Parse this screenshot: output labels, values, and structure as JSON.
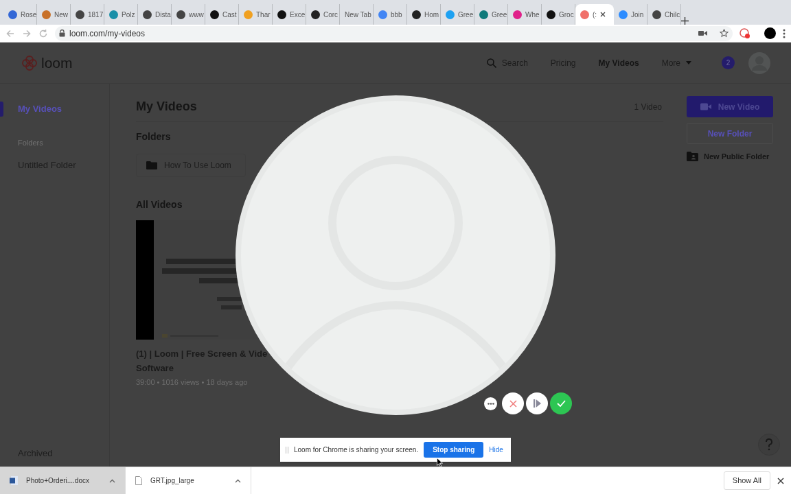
{
  "browser": {
    "tabs": [
      {
        "label": "Rose",
        "color": "#3367d6",
        "selected": false
      },
      {
        "label": "New",
        "color": "#c8712a",
        "selected": false
      },
      {
        "label": "1817",
        "color": "#444444",
        "selected": false
      },
      {
        "label": "Polz",
        "color": "#1a8fa8",
        "selected": false
      },
      {
        "label": "Dista",
        "color": "#444444",
        "selected": false
      },
      {
        "label": "www",
        "color": "#444444",
        "selected": false
      },
      {
        "label": "Cast",
        "color": "#111111",
        "selected": false
      },
      {
        "label": "Thar",
        "color": "#f0a020",
        "selected": false
      },
      {
        "label": "Exce",
        "color": "#111111",
        "selected": false
      },
      {
        "label": "Corc",
        "color": "#222222",
        "selected": false
      },
      {
        "label": "New Tab",
        "selected": false
      },
      {
        "label": "bbb",
        "color": "#4285f4",
        "selected": false
      },
      {
        "label": "Hom",
        "color": "#222222",
        "selected": false
      },
      {
        "label": "Gree",
        "color": "#1da1f2",
        "selected": false
      },
      {
        "label": "Gree",
        "color": "#0f7a7a",
        "selected": false
      },
      {
        "label": "Whe",
        "color": "#e0218a",
        "selected": false
      },
      {
        "label": "Groc",
        "color": "#111111",
        "selected": false
      },
      {
        "label": "(:",
        "color": "#f0706a",
        "selected": true
      },
      {
        "label": "Join",
        "color": "#2d8cff",
        "selected": false
      },
      {
        "label": "Chilc",
        "color": "#444444",
        "selected": false
      }
    ],
    "url": "loom.com/my-videos"
  },
  "header": {
    "logo": "loom",
    "nav": [
      {
        "label": "Search",
        "kind": "search",
        "selected": false
      },
      {
        "label": "Pricing",
        "kind": "link",
        "selected": false
      },
      {
        "label": "My Videos",
        "kind": "link",
        "selected": true
      },
      {
        "label": "More",
        "kind": "menu",
        "selected": false
      }
    ],
    "badge": "2"
  },
  "sidebar": {
    "items": [
      {
        "label": "My Videos",
        "selected": true
      }
    ],
    "folders_label": "Folders",
    "folders": [
      "Untitled Folder"
    ],
    "archived": "Archived"
  },
  "main": {
    "title": "My Videos",
    "video_count": "1 Video",
    "folders_heading": "Folders",
    "folders": [
      "How To Use Loom"
    ],
    "all_videos_heading": "All Videos",
    "videos": [
      {
        "title_lines": [
          "(1) | Loom | Free Screen & Vide",
          "Software"
        ],
        "meta": "39:00 • 1016 views • 18 days ago"
      }
    ]
  },
  "actions": {
    "new_video": "New Video",
    "new_folder": "New Folder",
    "new_public_folder": "New Public Folder"
  },
  "share_bar": {
    "message": "Loom for Chrome is sharing your screen.",
    "stop": "Stop sharing",
    "hide": "Hide"
  },
  "downloads": {
    "items": [
      {
        "name": "Photo+Orderi....docx",
        "kind": "doc",
        "selected": true
      },
      {
        "name": "GRT.jpg_large",
        "kind": "file",
        "selected": false
      }
    ],
    "show_all": "Show All"
  }
}
